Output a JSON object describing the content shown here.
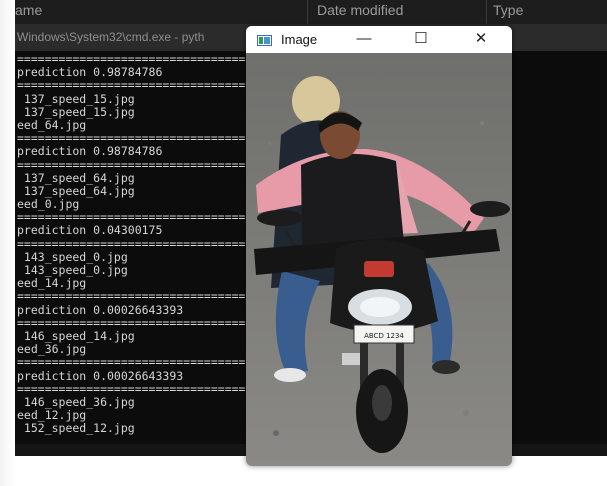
{
  "explorer": {
    "columns": [
      "ame",
      "Date modified",
      "Type"
    ]
  },
  "console": {
    "title": "Windows\\System32\\cmd.exe - pyth",
    "lines": [
      "=====================================",
      "prediction 0.98784786",
      "=====================================",
      " 137_speed_15.jpg",
      " 137_speed_15.jpg",
      "eed_64.jpg",
      "=====================================",
      "prediction 0.98784786",
      "=====================================",
      " 137_speed_64.jpg",
      " 137_speed_64.jpg",
      "eed_0.jpg",
      "=====================================",
      "prediction 0.04300175",
      "=====================================",
      " 143_speed_0.jpg",
      " 143_speed_0.jpg",
      "eed_14.jpg",
      "=====================================",
      "prediction 0.00026643393",
      "=====================================",
      " 146_speed_14.jpg",
      "eed_36.jpg",
      "=====================================",
      "prediction 0.00026643393",
      "=====================================",
      " 146_speed_36.jpg",
      "eed_12.jpg",
      " 152_speed_12.jpg"
    ]
  },
  "image_window": {
    "title": "Image",
    "minimize": "—",
    "maximize": "☐",
    "close": "✕",
    "plate_text": "ABCD 1234"
  },
  "colors": {
    "console_bg": "#0c0c0c",
    "console_text": "#d6d6d6",
    "shirt": "#e79aa7",
    "jeans": "#3a5d8f"
  }
}
